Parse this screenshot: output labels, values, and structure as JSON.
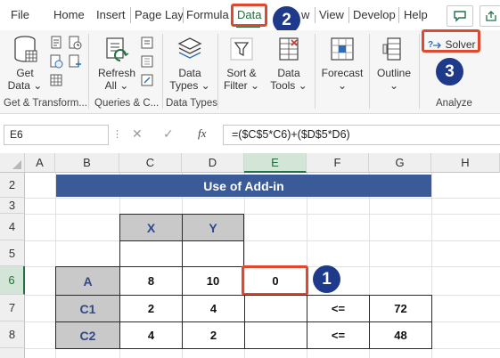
{
  "menu": {
    "tabs": [
      "File",
      "Home",
      "Insert",
      "Page Lay",
      "Formula",
      "Data",
      "w",
      "View",
      "Develop",
      "Help"
    ]
  },
  "ribbon": {
    "get_data": [
      "Get",
      "Data ⌄"
    ],
    "refresh_all": [
      "Refresh",
      "All ⌄"
    ],
    "data_types": [
      "Data",
      "Types ⌄"
    ],
    "sort_filter": [
      "Sort &",
      "Filter ⌄"
    ],
    "data_tools": [
      "Data",
      "Tools ⌄"
    ],
    "forecast": [
      "Forecast",
      "⌄"
    ],
    "outline": [
      "Outline",
      "⌄"
    ],
    "solver": "Solver",
    "groups": [
      "Get & Transform...",
      "Queries & C...",
      "Data Types",
      "Analyze"
    ]
  },
  "annotations": {
    "badge1": "1",
    "badge2": "2",
    "badge3": "3"
  },
  "formula_bar": {
    "name_box": "E6",
    "cancel": "✕",
    "enter": "✓",
    "fx": "fx",
    "formula": "=($C$5*C6)+($D$5*D6)"
  },
  "sheet": {
    "columns": [
      "A",
      "B",
      "C",
      "D",
      "E",
      "F",
      "G",
      "H"
    ],
    "rows": [
      "2",
      "3",
      "4",
      "5",
      "6",
      "7",
      "8"
    ],
    "title": "Use of Add-in",
    "header_x": "X",
    "header_y": "Y",
    "row_a": {
      "label": "A",
      "x": "8",
      "y": "10",
      "result": "0"
    },
    "row_c1": {
      "label": "C1",
      "x": "2",
      "y": "4",
      "op": "<=",
      "limit": "72"
    },
    "row_c2": {
      "label": "C2",
      "x": "4",
      "y": "2",
      "op": "<=",
      "limit": "48"
    }
  },
  "colors": {
    "accent_green": "#217346",
    "annotation_red": "#e0492f",
    "badge_blue": "#1f3a8a",
    "title_blue": "#3a5a98"
  }
}
